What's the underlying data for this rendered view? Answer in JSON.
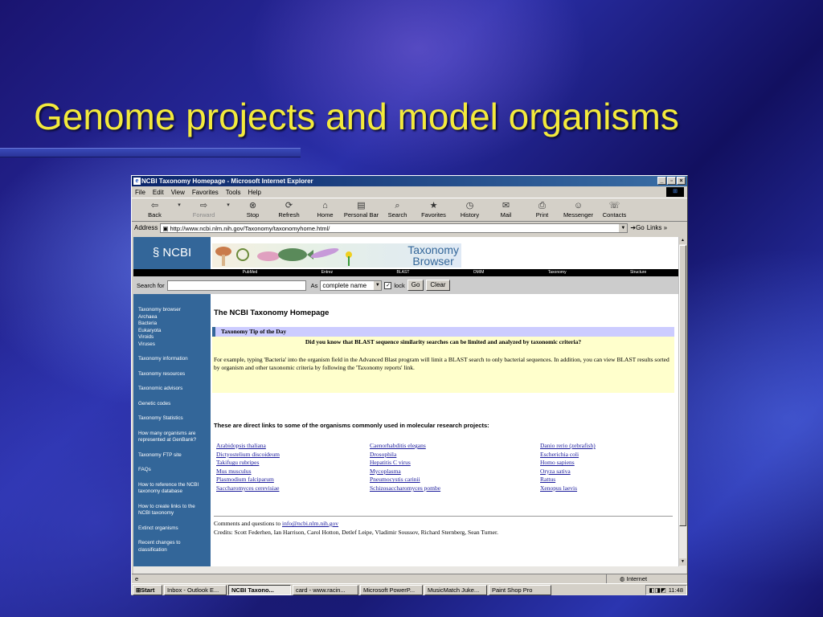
{
  "slide": {
    "title": "Genome projects and model organisms"
  },
  "window": {
    "title": "NCBI Taxonomy Homepage - Microsoft Internet Explorer",
    "minimize": "_",
    "maximize": "▫",
    "close": "×"
  },
  "menu": [
    "File",
    "Edit",
    "View",
    "Favorites",
    "Tools",
    "Help"
  ],
  "toolbar": [
    {
      "label": "Back",
      "icon": "⇦",
      "name": "back-button",
      "state": "enabled"
    },
    {
      "label": "Forward",
      "icon": "⇨",
      "name": "forward-button",
      "state": "disabled"
    },
    {
      "label": "Stop",
      "icon": "⊗",
      "name": "stop-button",
      "state": "enabled"
    },
    {
      "label": "Refresh",
      "icon": "⟳",
      "name": "refresh-button",
      "state": "enabled"
    },
    {
      "label": "Home",
      "icon": "⌂",
      "name": "home-button",
      "state": "enabled"
    },
    {
      "label": "Personal Bar",
      "icon": "▤",
      "name": "personal-bar-button",
      "state": "enabled"
    },
    {
      "label": "Search",
      "icon": "⌕",
      "name": "search-button",
      "state": "enabled"
    },
    {
      "label": "Favorites",
      "icon": "★",
      "name": "favorites-button",
      "state": "enabled"
    },
    {
      "label": "History",
      "icon": "◷",
      "name": "history-button",
      "state": "enabled"
    },
    {
      "label": "Mail",
      "icon": "✉",
      "name": "mail-button",
      "state": "enabled"
    },
    {
      "label": "Print",
      "icon": "⎙",
      "name": "print-button",
      "state": "enabled"
    },
    {
      "label": "Messenger",
      "icon": "☺",
      "name": "messenger-button",
      "state": "enabled"
    },
    {
      "label": "Contacts",
      "icon": "☏",
      "name": "contacts-button",
      "state": "enabled"
    }
  ],
  "address": {
    "label": "Address",
    "url": "http://www.ncbi.nlm.nih.gov/Taxonomy/taxonomyhome.html/",
    "go": "Go",
    "links": "Links »"
  },
  "page": {
    "logo": "NCBI",
    "banner_title_1": "Taxonomy",
    "banner_title_2": "Browser",
    "nav": [
      "PubMed",
      "Entrez",
      "BLAST",
      "OMIM",
      "Taxonomy",
      "Structure"
    ],
    "search_label": "Search for",
    "as_label": "As",
    "mode_selected": "complete name",
    "lock_label": "lock",
    "go_label": "Go",
    "clear_label": "Clear",
    "sidebar": [
      "Taxonomy browser",
      "Archaea",
      "Bacteria",
      "Eukaryota",
      "Viroids",
      "Viruses",
      "",
      "Taxonomy information",
      "",
      "Taxonomy resources",
      "",
      "Taxonomic advisors",
      "",
      "Genetic codes",
      "",
      "Taxonomy Statistics",
      "",
      "How many organisms are",
      "represented at GenBank?",
      "",
      "Taxonomy FTP site",
      "",
      "FAQs",
      "",
      "How to reference the NCBI",
      "taxonomy database",
      "",
      "How to create links to the",
      "NCBI taxonomy",
      "",
      "Extinct organisms",
      "",
      "Recent changes to",
      "classification"
    ],
    "heading": "The NCBI Taxonomy Homepage",
    "tip_title": "Taxonomy Tip of the Day",
    "tip_question": "Did you know that BLAST sequence similarity searches can be limited and analyzed by taxonomic criteria?",
    "tip_text": "For example, typing 'Bacteria' into the organism field in the Advanced Blast program will limit a BLAST search to only bacterial sequences. In addition, you can view BLAST results sorted by organism and other taxonomic criteria by following the 'Taxonomy reports' link.",
    "links_intro": "These are direct links to some of the organisms commonly used in molecular research projects:",
    "organisms": [
      "Arabidopsis thaliana",
      "Caenorhabditis elegans",
      "Danio rerio (zebrafish)",
      "Dictyostelium discoideum",
      "Drosophila",
      "Escherichia coli",
      "Takifugu rubripes",
      "Hepatitis C virus",
      "Homo sapiens",
      "Mus musculus",
      "Mycoplasma",
      "Oryza sativa",
      "Plasmodium falciparum",
      "Pneumocystis carinii",
      "Rattus",
      "Saccharomyces cerevisiae",
      "Schizosaccharomyces pombe",
      "Xenopus laevis"
    ],
    "comments_prefix": "Comments and questions to",
    "comments_email": "info@ncbi.nlm.nih.gov",
    "credits": "Credits: Scott Federhen, Ian Harrison, Carol Hotton, Detlef Leipe, Vladimir Soussov, Richard Sternberg, Sean Turner."
  },
  "status": {
    "left": "e",
    "zone": "Internet"
  },
  "taskbar": {
    "start": "Start",
    "tasks": [
      "Inbox - Outlook E...",
      "NCBI Taxono...",
      "card - www.racin...",
      "Microsoft PowerP...",
      "MusicMatch Juke...",
      "Paint Shop Pro"
    ],
    "clock": "11:48"
  },
  "colors": {
    "title": "#f3ea3c",
    "ncbi_blue": "#336699",
    "tip_header": "#ccccff",
    "tip_body": "#ffffcc"
  }
}
